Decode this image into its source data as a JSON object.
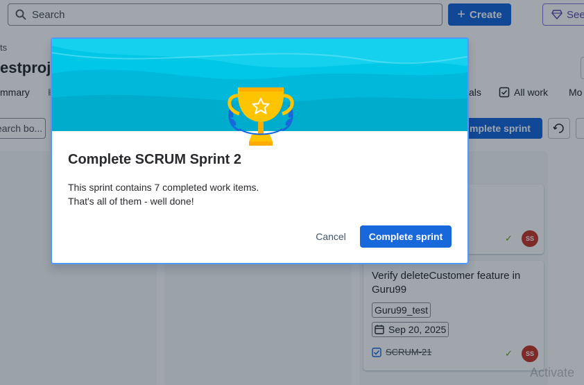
{
  "topbar": {
    "search_placeholder": "Search",
    "create_label": "Create",
    "see_label": "See"
  },
  "project": {
    "breadcrumb_fragment": "ts",
    "title_fragment": "estproje"
  },
  "tabs": {
    "summary_fragment": "mmary",
    "goals_fragment": "als",
    "all_work": "All work",
    "more_fragment": "Mo"
  },
  "board": {
    "filter_placeholder": "earch bo...",
    "complete_sprint_fragment": "mplete sprint",
    "column_fragment": "o"
  },
  "cards": [
    {
      "assignee_initials": "SS"
    },
    {
      "title": "Verify deleteCustomer feature in Guru99",
      "label": "Guru99_test",
      "due_date": "Sep 20, 2025",
      "key": "SCRUM-21",
      "assignee_initials": "SS"
    }
  ],
  "watermark": "Activate",
  "modal": {
    "title": "Complete SCRUM Sprint 2",
    "body_line1": "This sprint contains 7 completed work items.",
    "body_line2": "That's all of them - well done!",
    "cancel_label": "Cancel",
    "confirm_label": "Complete sprint"
  },
  "colors": {
    "primary": "#1868db",
    "banner_light": "#79e2f2",
    "banner_dark": "#00b8d9",
    "trophy_gold": "#ffc400",
    "avatar_red": "#c9372c"
  },
  "icons": {
    "search": "search-icon",
    "plus": "plus-icon",
    "gem": "gem-icon",
    "trophy": "trophy-icon",
    "calendar": "calendar-icon",
    "checkbox": "story-checkbox-icon",
    "check": "check-icon"
  }
}
